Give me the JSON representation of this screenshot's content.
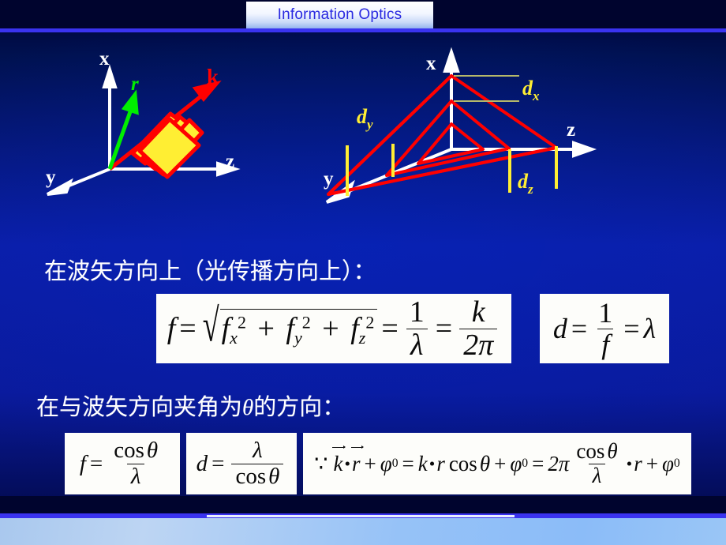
{
  "slide": {
    "title": "Information Optics",
    "accent_blue": "#3a33f0",
    "background_blue": "#0a1a9c",
    "title_text_color": "#2929e0"
  },
  "figures": {
    "left": {
      "name": "wavefront-plane-wave-diagram",
      "axis_labels": {
        "x": "x",
        "y": "y",
        "z": "z"
      },
      "vectors": [
        {
          "label": "r",
          "color": "#00ee00"
        },
        {
          "label": "k",
          "color": "#ff0000"
        }
      ],
      "plane_color": "#ffee33",
      "plane_outline": "#ff0000",
      "axis_color": "#ffffff"
    },
    "right": {
      "name": "spatial-period-projection-diagram",
      "axis_labels": {
        "x": "x",
        "y": "y",
        "z": "z"
      },
      "dimension_labels": [
        {
          "label": "d",
          "subscript": "x",
          "color": "#ffee33"
        },
        {
          "label": "d",
          "subscript": "y",
          "color": "#ffee33"
        },
        {
          "label": "d",
          "subscript": "z",
          "color": "#ffee33"
        }
      ],
      "ray_color": "#ff0000",
      "axis_color": "#ffffff"
    }
  },
  "text": {
    "line1": "在波矢方向上（光传播方向上）：",
    "line2_before": "在与波矢方向夹角为",
    "line2_symbol": "θ",
    "line2_after": "的方向："
  },
  "formulas": {
    "f_magnitude": {
      "lhs": "f",
      "terms": [
        "f",
        "f",
        "f"
      ],
      "subs": [
        "x",
        "y",
        "z"
      ],
      "exponent": "2",
      "eq1_num": "1",
      "eq1_den": "λ",
      "eq2_num": "k",
      "eq2_den": "2π",
      "plus": "+",
      "equals": "=",
      "radical": "√"
    },
    "d_equals": {
      "lhs": "d",
      "equals": "=",
      "num": "1",
      "den": "f",
      "rhs": "λ"
    },
    "f_cos": {
      "lhs": "f",
      "equals": "=",
      "num": "cos",
      "num_sym": "θ",
      "den": "λ"
    },
    "d_cos": {
      "lhs": "d",
      "equals": "=",
      "num": "λ",
      "den": "cos",
      "den_sym": "θ"
    },
    "phase": {
      "because": "∵",
      "k_vec": "k",
      "dot": "•",
      "r_vec": "r",
      "plus": "+",
      "phi": "φ",
      "phi_sub": "0",
      "equals": "=",
      "k": "k",
      "r": "r",
      "cos": "cos",
      "theta": "θ",
      "two_pi": "2π",
      "frac_num_cos": "cos",
      "frac_num_theta": "θ",
      "frac_den": "λ"
    }
  }
}
